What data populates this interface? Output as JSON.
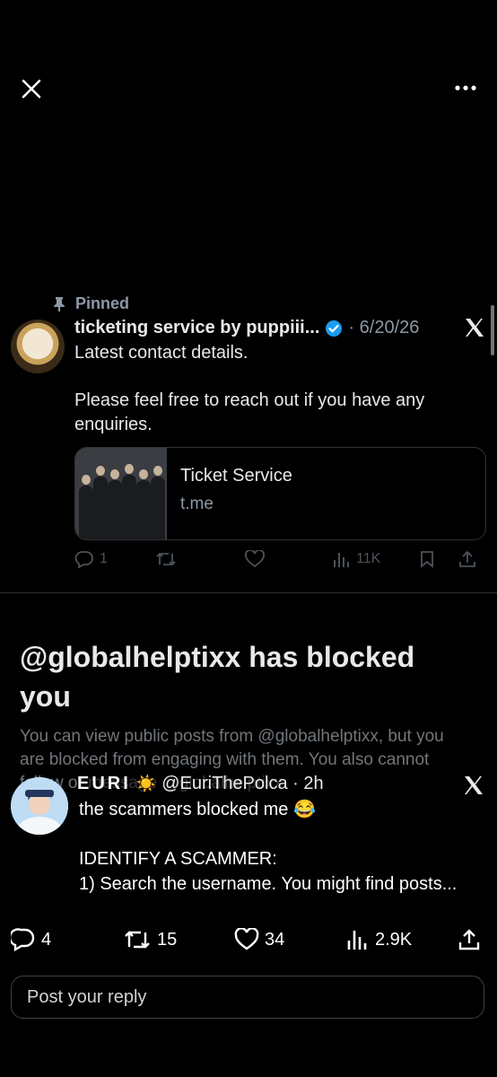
{
  "top_bar": {
    "close_icon": "close-icon",
    "more_icon": "more-horizontal-icon"
  },
  "pinned_tweet": {
    "pinned_label": "Pinned",
    "display_name": "ticketing service by puppiii...",
    "date": "· 6/20/26",
    "body_lines": [
      "Latest contact details.",
      "Please feel free to reach out if you have any enquiries."
    ],
    "card": {
      "title": "Ticket Service",
      "domain": "t.me"
    },
    "actions": {
      "replies": "1",
      "reposts": "",
      "likes": "",
      "views": "11K"
    }
  },
  "blocked_notice": {
    "title": "@globalhelptixx has blocked you",
    "description": "You can view public posts from @globalhelptixx, but you are blocked from engaging with them. You also cannot follow or message @globalhelptixx."
  },
  "reply_tweet": {
    "display_name": "EURI",
    "emoji": "☀️",
    "handle_time": "@EuriThePolca · 2h",
    "line1": "the scammers blocked me 😂",
    "line2": "IDENTIFY A SCAMMER:",
    "line3": "1) Search the username. You might find posts..."
  },
  "action_bar": {
    "replies": "4",
    "reposts": "15",
    "likes": "34",
    "views": "2.9K"
  },
  "reply_input": {
    "placeholder": "Post your reply"
  }
}
